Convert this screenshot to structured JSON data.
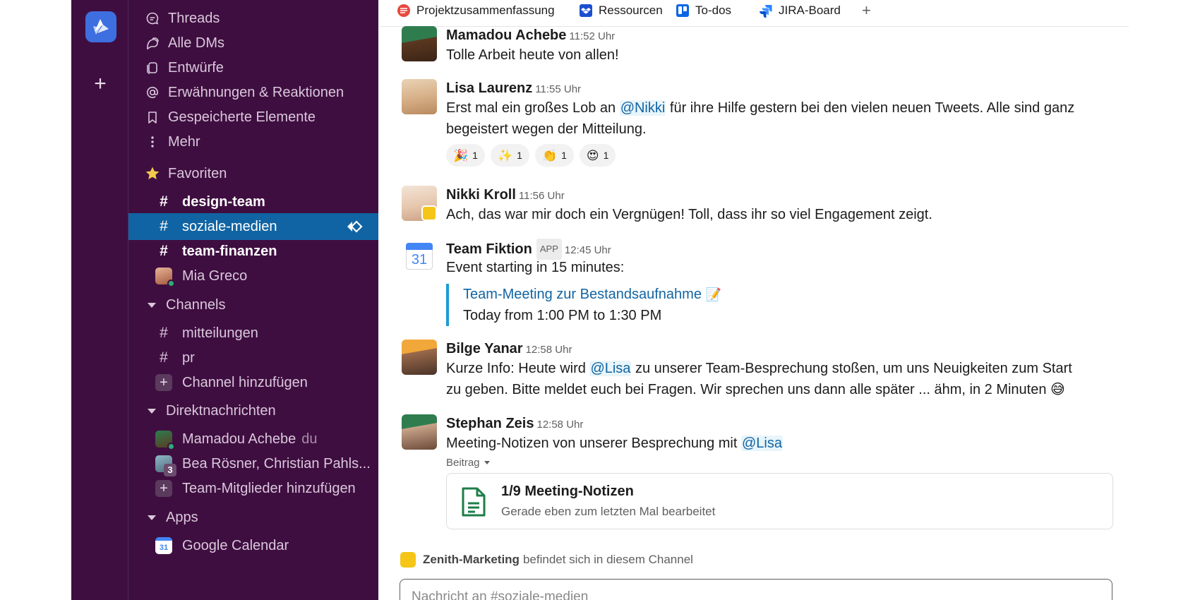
{
  "sidebar": {
    "nav": [
      {
        "label": "Threads",
        "icon": "threads-icon"
      },
      {
        "label": "Alle DMs",
        "icon": "dms-icon"
      },
      {
        "label": "Entwürfe",
        "icon": "drafts-icon"
      },
      {
        "label": "Erwähnungen & Reaktionen",
        "icon": "at-icon"
      },
      {
        "label": "Gespeicherte Elemente",
        "icon": "bookmark-icon"
      },
      {
        "label": "Mehr",
        "icon": "more-icon"
      }
    ],
    "favorites_label": "Favoriten",
    "favorites": [
      {
        "label": "design-team"
      },
      {
        "label": "soziale-medien"
      },
      {
        "label": "team-finanzen"
      },
      {
        "label": "Mia Greco"
      }
    ],
    "channels_label": "Channels",
    "channels": [
      {
        "label": "mitteilungen"
      },
      {
        "label": "pr"
      }
    ],
    "add_channel_label": "Channel hinzufügen",
    "dms_label": "Direktnachrichten",
    "dms": [
      {
        "label": "Mamadou Achebe",
        "suffix": "du"
      },
      {
        "label": "Bea Rösner, Christian Pahls...",
        "count": "3"
      }
    ],
    "add_members_label": "Team-Mitglieder hinzufügen",
    "apps_label": "Apps",
    "apps": [
      {
        "label": "Google Calendar",
        "icon_text": "31"
      }
    ]
  },
  "bookmarks": [
    {
      "label": "Projektzusammenfassung"
    },
    {
      "label": "Ressourcen"
    },
    {
      "label": "To-dos"
    },
    {
      "label": "JIRA-Board"
    }
  ],
  "messages": [
    {
      "name": "Mamadou Achebe",
      "time": "11:52 Uhr",
      "text": "Tolle Arbeit heute von allen!"
    },
    {
      "name": "Lisa Laurenz",
      "time": "11:55 Uhr",
      "text_before": "Erst mal ein großes Lob an ",
      "mention": "@Nikki",
      "text_after": " für ihre Hilfe gestern bei den vielen neuen Tweets. Alle sind ganz begeistert wegen der Mitteilung.",
      "reactions": [
        {
          "emoji": "🎉",
          "count": "1"
        },
        {
          "emoji": "✨",
          "count": "1"
        },
        {
          "emoji": "👏",
          "count": "1"
        },
        {
          "emoji": "😍",
          "count": "1"
        }
      ]
    },
    {
      "name": "Nikki Kroll",
      "time": "11:56 Uhr",
      "text": "Ach, das war mir doch ein Vergnügen! Toll, dass ihr so viel Engagement zeigt."
    },
    {
      "name": "Team Fiktion",
      "tag": "APP",
      "time": "12:45 Uhr",
      "text": "Event starting in 15 minutes:",
      "event_title": "Team-Meeting zur Bestandsaufnahme",
      "event_emoji": "📝",
      "event_time": "Today from 1:00 PM to 1:30 PM",
      "calendar_day": "31"
    },
    {
      "name": "Bilge Yanar",
      "time": "12:58 Uhr",
      "text_before": "Kurze Info: Heute wird ",
      "mention": "@Lisa",
      "text_after": " zu unserer Team-Besprechung stoßen, um uns Neuigkeiten zum Start zu geben. Bitte meldet euch bei Fragen. Wir sprechen uns dann alle später ... ähm, in 2 Minuten",
      "trailing_emoji": "😅"
    },
    {
      "name": "Stephan Zeis",
      "time": "12:58 Uhr",
      "text_before": "Meeting-Notizen von unserer Besprechung mit ",
      "mention": "@Lisa",
      "attachment_label": "Beitrag",
      "doc_title": "1/9 Meeting-Notizen",
      "doc_subtitle": "Gerade eben zum letzten Mal bearbeitet"
    }
  ],
  "member_note": {
    "app": "Zenith-Marketing",
    "text": "befindet sich in diesem Channel"
  },
  "composer": {
    "placeholder": "Nachricht an #soziale-medien"
  },
  "colors": {
    "sidebar_bg": "#3f0e40",
    "active_bg": "#1164a3",
    "link": "#1264a3",
    "workspace": "#3e6fe0"
  }
}
